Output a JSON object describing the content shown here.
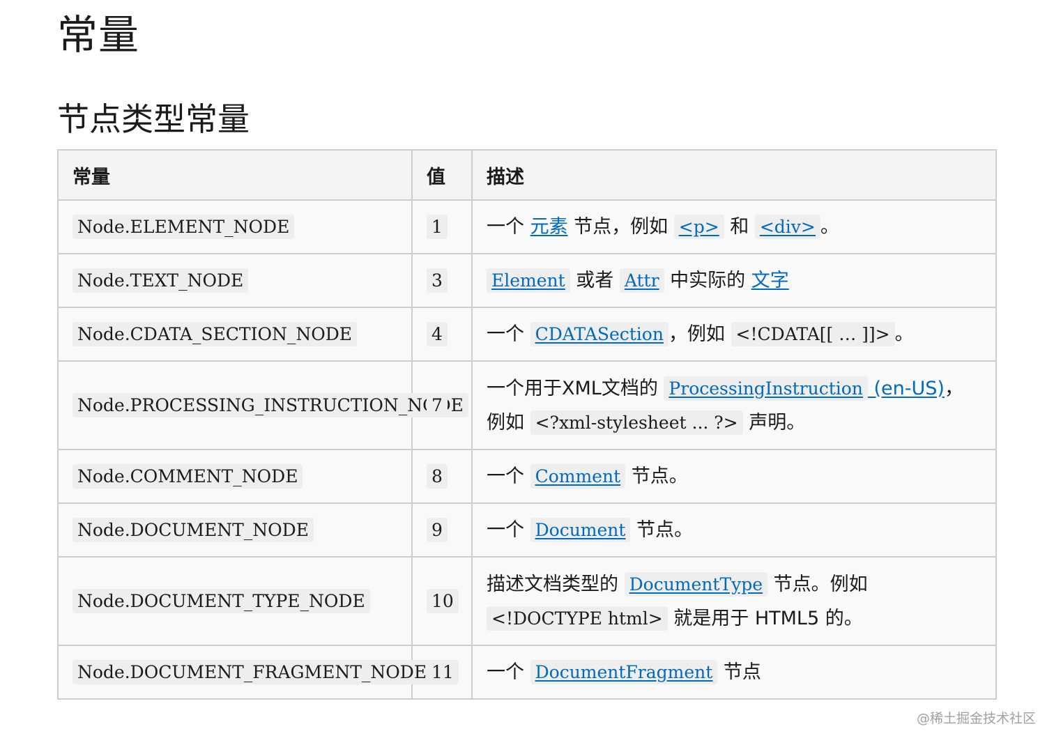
{
  "page_title": "常量",
  "section_title": "节点类型常量",
  "table": {
    "headers": [
      "常量",
      "值",
      "描述"
    ],
    "rows": [
      {
        "constant": "Node.ELEMENT_NODE",
        "value": "1",
        "desc": [
          {
            "t": "text",
            "v": "一个 "
          },
          {
            "t": "link",
            "v": "元素"
          },
          {
            "t": "text",
            "v": " 节点，例如 "
          },
          {
            "t": "linkcode",
            "v": "<p>"
          },
          {
            "t": "text",
            "v": " 和 "
          },
          {
            "t": "linkcode",
            "v": "<div>"
          },
          {
            "t": "text",
            "v": "。"
          }
        ]
      },
      {
        "constant": "Node.TEXT_NODE",
        "value": "3",
        "desc": [
          {
            "t": "linkcode",
            "v": "Element"
          },
          {
            "t": "text",
            "v": " 或者 "
          },
          {
            "t": "linkcode",
            "v": "Attr"
          },
          {
            "t": "text",
            "v": " 中实际的 "
          },
          {
            "t": "link",
            "v": "文字"
          }
        ]
      },
      {
        "constant": "Node.CDATA_SECTION_NODE",
        "value": "4",
        "desc": [
          {
            "t": "text",
            "v": "一个 "
          },
          {
            "t": "linkcode",
            "v": "CDATASection"
          },
          {
            "t": "text",
            "v": "，例如 "
          },
          {
            "t": "code",
            "v": "<!CDATA[[ … ]]>"
          },
          {
            "t": "text",
            "v": "。"
          }
        ]
      },
      {
        "constant": "Node.PROCESSING_INSTRUCTION_NODE",
        "value": "7",
        "desc": [
          {
            "t": "text",
            "v": "一个用于XML文档的 "
          },
          {
            "t": "linkcode",
            "v": "ProcessingInstruction"
          },
          {
            "t": "link",
            "v": " (en-US)"
          },
          {
            "t": "text",
            "v": "，例如 "
          },
          {
            "t": "code",
            "v": "<?xml-stylesheet ... ?>"
          },
          {
            "t": "text",
            "v": " 声明。"
          }
        ]
      },
      {
        "constant": "Node.COMMENT_NODE",
        "value": "8",
        "desc": [
          {
            "t": "text",
            "v": "一个 "
          },
          {
            "t": "linkcode",
            "v": "Comment"
          },
          {
            "t": "text",
            "v": " 节点。"
          }
        ]
      },
      {
        "constant": "Node.DOCUMENT_NODE",
        "value": "9",
        "desc": [
          {
            "t": "text",
            "v": "一个 "
          },
          {
            "t": "linkcode",
            "v": "Document"
          },
          {
            "t": "text",
            "v": " 节点。"
          }
        ]
      },
      {
        "constant": "Node.DOCUMENT_TYPE_NODE",
        "value": "10",
        "desc": [
          {
            "t": "text",
            "v": "描述文档类型的 "
          },
          {
            "t": "linkcode",
            "v": "DocumentType"
          },
          {
            "t": "text",
            "v": " 节点。例如 "
          },
          {
            "t": "code",
            "v": "<!DOCTYPE html>"
          },
          {
            "t": "text",
            "v": " 就是用于 HTML5 的。"
          }
        ]
      },
      {
        "constant": "Node.DOCUMENT_FRAGMENT_NODE",
        "value": "11",
        "desc": [
          {
            "t": "text",
            "v": "一个 "
          },
          {
            "t": "linkcode",
            "v": "DocumentFragment"
          },
          {
            "t": "text",
            "v": " 节点"
          }
        ]
      }
    ]
  },
  "watermark": "@稀土掘金技术社区"
}
